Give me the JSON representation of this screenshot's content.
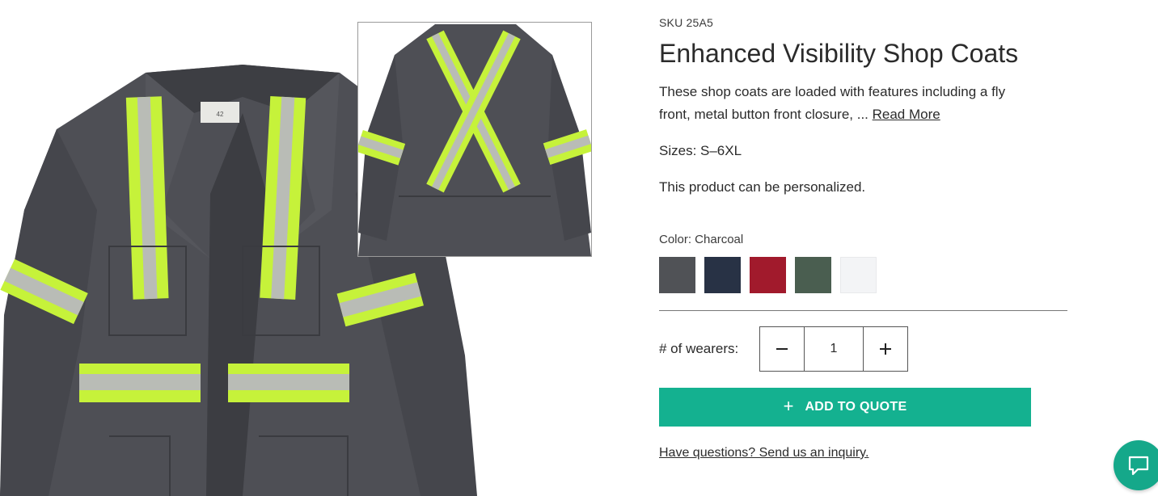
{
  "product": {
    "sku": "SKU 25A5",
    "title": "Enhanced Visibility Shop Coats",
    "description": "These shop coats are loaded with features including a fly front, metal button front closure, ... ",
    "read_more": "Read More",
    "sizes": "Sizes: S–6XL",
    "personalized": "This product can be personalized.",
    "color_label": "Color: Charcoal",
    "swatches": [
      {
        "color": "#505256"
      },
      {
        "color": "#283245"
      },
      {
        "color": "#a11a2c"
      },
      {
        "color": "#4a5e50"
      },
      {
        "color": "#f3f4f6"
      }
    ],
    "label_tag": "42",
    "wearers_label": "# of wearers:",
    "quantity": "1",
    "decrement_symbol": "–",
    "increment_symbol": "+",
    "add_button": {
      "icon": "+",
      "label": "ADD TO QUOTE"
    },
    "inquiry_link": "Have questions? Send us an inquiry."
  },
  "colors": {
    "accent": "#14b190",
    "coat": "#4e4f55",
    "reflective_yellow": "#c6f23a",
    "reflective_silver": "#b9bcb6"
  },
  "icons": {
    "chat": "chat-icon",
    "plus": "plus-icon",
    "minus": "minus-icon"
  }
}
